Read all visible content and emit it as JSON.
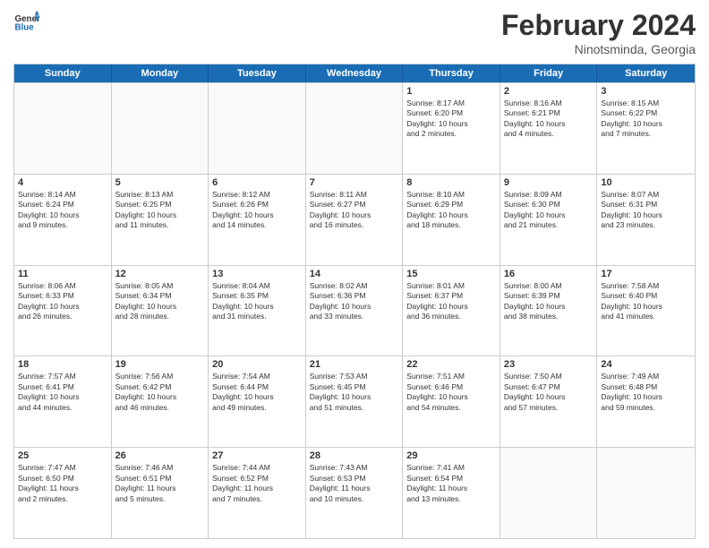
{
  "header": {
    "logo_line1": "General",
    "logo_line2": "Blue",
    "month_title": "February 2024",
    "subtitle": "Ninotsminda, Georgia"
  },
  "weekdays": [
    "Sunday",
    "Monday",
    "Tuesday",
    "Wednesday",
    "Thursday",
    "Friday",
    "Saturday"
  ],
  "rows": [
    [
      {
        "num": "",
        "info": "",
        "empty": true
      },
      {
        "num": "",
        "info": "",
        "empty": true
      },
      {
        "num": "",
        "info": "",
        "empty": true
      },
      {
        "num": "",
        "info": "",
        "empty": true
      },
      {
        "num": "1",
        "info": "Sunrise: 8:17 AM\nSunset: 6:20 PM\nDaylight: 10 hours\nand 2 minutes."
      },
      {
        "num": "2",
        "info": "Sunrise: 8:16 AM\nSunset: 6:21 PM\nDaylight: 10 hours\nand 4 minutes."
      },
      {
        "num": "3",
        "info": "Sunrise: 8:15 AM\nSunset: 6:22 PM\nDaylight: 10 hours\nand 7 minutes."
      }
    ],
    [
      {
        "num": "4",
        "info": "Sunrise: 8:14 AM\nSunset: 6:24 PM\nDaylight: 10 hours\nand 9 minutes."
      },
      {
        "num": "5",
        "info": "Sunrise: 8:13 AM\nSunset: 6:25 PM\nDaylight: 10 hours\nand 11 minutes."
      },
      {
        "num": "6",
        "info": "Sunrise: 8:12 AM\nSunset: 6:26 PM\nDaylight: 10 hours\nand 14 minutes."
      },
      {
        "num": "7",
        "info": "Sunrise: 8:11 AM\nSunset: 6:27 PM\nDaylight: 10 hours\nand 16 minutes."
      },
      {
        "num": "8",
        "info": "Sunrise: 8:10 AM\nSunset: 6:29 PM\nDaylight: 10 hours\nand 18 minutes."
      },
      {
        "num": "9",
        "info": "Sunrise: 8:09 AM\nSunset: 6:30 PM\nDaylight: 10 hours\nand 21 minutes."
      },
      {
        "num": "10",
        "info": "Sunrise: 8:07 AM\nSunset: 6:31 PM\nDaylight: 10 hours\nand 23 minutes."
      }
    ],
    [
      {
        "num": "11",
        "info": "Sunrise: 8:06 AM\nSunset: 6:33 PM\nDaylight: 10 hours\nand 26 minutes."
      },
      {
        "num": "12",
        "info": "Sunrise: 8:05 AM\nSunset: 6:34 PM\nDaylight: 10 hours\nand 28 minutes."
      },
      {
        "num": "13",
        "info": "Sunrise: 8:04 AM\nSunset: 6:35 PM\nDaylight: 10 hours\nand 31 minutes."
      },
      {
        "num": "14",
        "info": "Sunrise: 8:02 AM\nSunset: 6:36 PM\nDaylight: 10 hours\nand 33 minutes."
      },
      {
        "num": "15",
        "info": "Sunrise: 8:01 AM\nSunset: 6:37 PM\nDaylight: 10 hours\nand 36 minutes."
      },
      {
        "num": "16",
        "info": "Sunrise: 8:00 AM\nSunset: 6:39 PM\nDaylight: 10 hours\nand 38 minutes."
      },
      {
        "num": "17",
        "info": "Sunrise: 7:58 AM\nSunset: 6:40 PM\nDaylight: 10 hours\nand 41 minutes."
      }
    ],
    [
      {
        "num": "18",
        "info": "Sunrise: 7:57 AM\nSunset: 6:41 PM\nDaylight: 10 hours\nand 44 minutes."
      },
      {
        "num": "19",
        "info": "Sunrise: 7:56 AM\nSunset: 6:42 PM\nDaylight: 10 hours\nand 46 minutes."
      },
      {
        "num": "20",
        "info": "Sunrise: 7:54 AM\nSunset: 6:44 PM\nDaylight: 10 hours\nand 49 minutes."
      },
      {
        "num": "21",
        "info": "Sunrise: 7:53 AM\nSunset: 6:45 PM\nDaylight: 10 hours\nand 51 minutes."
      },
      {
        "num": "22",
        "info": "Sunrise: 7:51 AM\nSunset: 6:46 PM\nDaylight: 10 hours\nand 54 minutes."
      },
      {
        "num": "23",
        "info": "Sunrise: 7:50 AM\nSunset: 6:47 PM\nDaylight: 10 hours\nand 57 minutes."
      },
      {
        "num": "24",
        "info": "Sunrise: 7:49 AM\nSunset: 6:48 PM\nDaylight: 10 hours\nand 59 minutes."
      }
    ],
    [
      {
        "num": "25",
        "info": "Sunrise: 7:47 AM\nSunset: 6:50 PM\nDaylight: 11 hours\nand 2 minutes."
      },
      {
        "num": "26",
        "info": "Sunrise: 7:46 AM\nSunset: 6:51 PM\nDaylight: 11 hours\nand 5 minutes."
      },
      {
        "num": "27",
        "info": "Sunrise: 7:44 AM\nSunset: 6:52 PM\nDaylight: 11 hours\nand 7 minutes."
      },
      {
        "num": "28",
        "info": "Sunrise: 7:43 AM\nSunset: 6:53 PM\nDaylight: 11 hours\nand 10 minutes."
      },
      {
        "num": "29",
        "info": "Sunrise: 7:41 AM\nSunset: 6:54 PM\nDaylight: 11 hours\nand 13 minutes."
      },
      {
        "num": "",
        "info": "",
        "empty": true
      },
      {
        "num": "",
        "info": "",
        "empty": true
      }
    ]
  ]
}
